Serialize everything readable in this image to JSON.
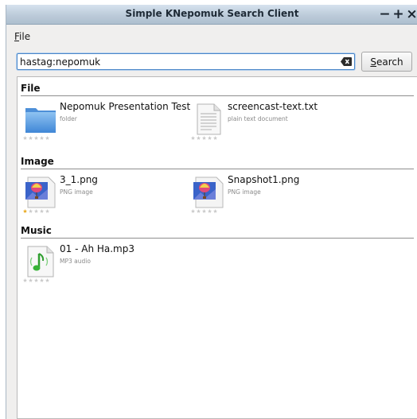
{
  "window": {
    "title": "Simple KNepomuk Search Client",
    "controls": [
      "−",
      "+",
      "×"
    ]
  },
  "menubar": {
    "file_mnemonic": "F",
    "file_rest": "ile"
  },
  "search": {
    "query": "hastag:nepomuk",
    "button_mnemonic": "S",
    "button_rest": "earch"
  },
  "groups": [
    {
      "title": "File",
      "items": [
        {
          "name": "Nepomuk Presentation Test",
          "type": "folder",
          "icon": "folder-icon",
          "rating": 0
        },
        {
          "name": "screencast-text.txt",
          "type": "plain text document",
          "icon": "text-document-icon",
          "rating": 0
        }
      ]
    },
    {
      "title": "Image",
      "items": [
        {
          "name": "3_1.png",
          "type": "PNG image",
          "icon": "png-image-icon",
          "rating": 1
        },
        {
          "name": "Snapshot1.png",
          "type": "PNG image",
          "icon": "png-image-icon",
          "rating": 0
        }
      ]
    },
    {
      "title": "Music",
      "items": [
        {
          "name": "01 - Ah Ha.mp3",
          "type": "MP3 audio",
          "icon": "mp3-audio-icon",
          "rating": 0
        }
      ]
    }
  ],
  "rating_max": 5,
  "colors": {
    "titlebar": "#bccbd9",
    "window_bg": "#f0efee",
    "input_focus": "#4a86c8",
    "star_on": "#e8a81c",
    "star_off": "#c9c9c9",
    "folder": "#5b9de0"
  }
}
